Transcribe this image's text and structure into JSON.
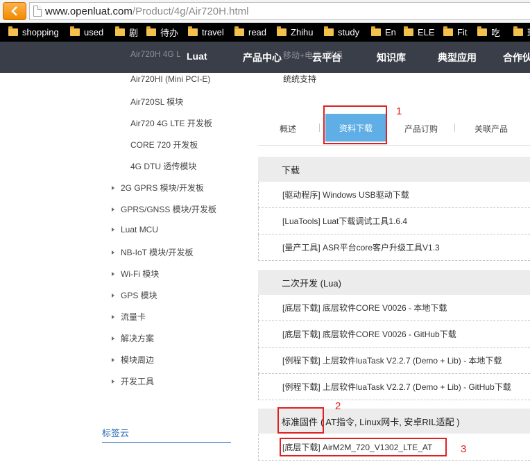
{
  "browser": {
    "url_domain": "www.openluat.com",
    "url_path": "/Product/4g/Air720H.html"
  },
  "bookmarks": [
    "shopping",
    "used",
    "剧",
    "待办",
    "travel",
    "read",
    "Zhihu",
    "study",
    "En",
    "ELE",
    "Fit",
    "吃",
    "理"
  ],
  "nav": {
    "items": [
      "Luat",
      "产品中心",
      "云平台",
      "知识库",
      "典型应用",
      "合作伙"
    ],
    "ghost_left": "Air720H 4G L",
    "ghost_right": "移动+电信+联通"
  },
  "sidebar": {
    "sub_items": [
      "Air720HI (Mini PCI-E)",
      "Air720SL 模块",
      "Air720 4G LTE 开发板",
      "CORE 720 开发板",
      "4G DTU 透传模块"
    ],
    "categories": [
      "2G GPRS 模块/开发板",
      "GPRS/GNSS 模块/开发板",
      "Luat MCU",
      "NB-IoT 模块/开发板",
      "Wi-Fi 模块",
      "GPS 模块",
      "流量卡",
      "解决方案",
      "模块周边",
      "开发工具"
    ],
    "tag_cloud": "标签云"
  },
  "product": {
    "feature_text": "统统支持"
  },
  "tabs": {
    "overview": "概述",
    "downloads": "资料下载",
    "order": "产品订购",
    "related": "关联产品"
  },
  "sections": [
    {
      "title": "下载",
      "rows": [
        "[驱动程序] Windows USB驱动下载",
        "[LuaTools] Luat下载调试工具1.6.4",
        "[量产工具] ASR平台core客户升级工具V1.3"
      ]
    },
    {
      "title": "二次开发 (Lua)",
      "rows": [
        "[底层下载] 底层软件CORE V0026 - 本地下载",
        "[底层下载] 底层软件CORE V0026 - GitHub下载",
        "[例程下载] 上层软件luaTask V2.2.7 (Demo + Lib) - 本地下载",
        "[例程下载] 上层软件luaTask V2.2.7 (Demo + Lib) - GitHub下载"
      ]
    },
    {
      "title_main": "标准固件",
      "title_rest": "( AT指令, Linux网卡, 安卓RIL适配 )",
      "rows": [
        "[底层下载] AirM2M_720_V1302_LTE_AT"
      ]
    }
  ],
  "annotations": [
    "1",
    "2",
    "3"
  ],
  "colors": {
    "nav_bg": "#3a3e48",
    "tab_active": "#5faee6",
    "annotation_red": "#e02020",
    "section_bg": "#ececec",
    "link_blue": "#2a6bb8"
  }
}
